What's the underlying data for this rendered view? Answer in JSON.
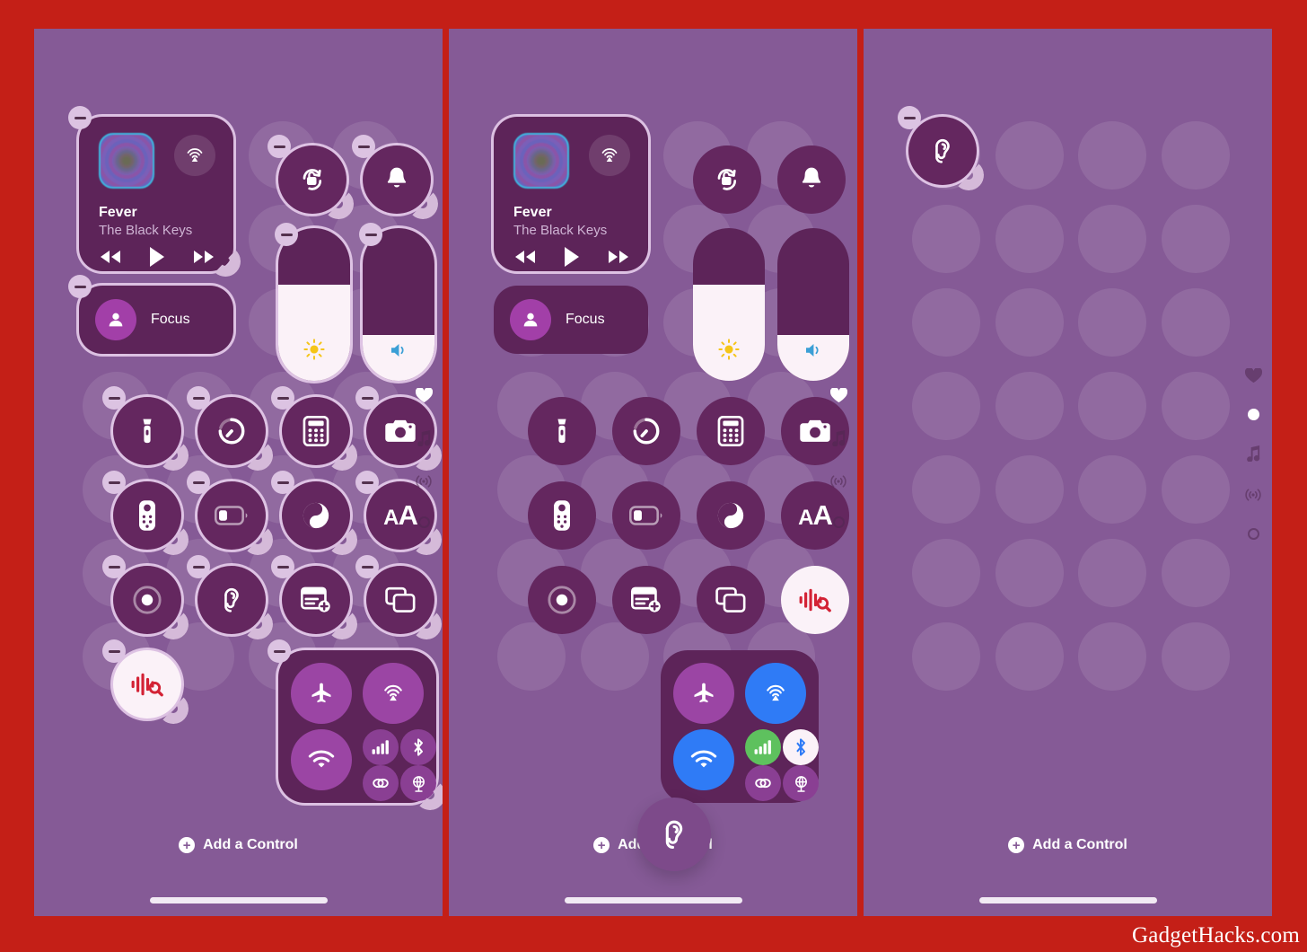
{
  "watermark": "GadgetHacks.com",
  "colors": {
    "border_red": "#c41f17",
    "panel_bg": "#855a96",
    "tile_bg": "#64275f",
    "widget_bg": "#5d2459",
    "minus_badge": "#dcc3e2",
    "handle": "#d5bad9",
    "active_blue": "#2f7bf6",
    "active_green": "#5ec15e",
    "shazam_red": "#d32235",
    "brightness_yellow": "#f5c518",
    "volume_blue": "#3b9fd6"
  },
  "panels": [
    {
      "id": "panel-1",
      "name": "control-center-edit-mode",
      "edit_mode": true,
      "add_control_label": "Add a Control",
      "media": {
        "title": "Fever",
        "artist": "The Black Keys",
        "airplay_icon": "airplay-icon",
        "rewind_icon": "rewind-icon",
        "play_icon": "play-icon",
        "forward_icon": "fast-forward-icon"
      },
      "focus": {
        "label": "Focus",
        "icon": "person-icon"
      },
      "toggles": [
        {
          "name": "rotation-lock",
          "icon": "rotation-lock-icon"
        },
        {
          "name": "ring-silent",
          "icon": "bell-icon"
        }
      ],
      "sliders": [
        {
          "name": "brightness-slider",
          "icon": "sun-icon",
          "level": 63
        },
        {
          "name": "volume-slider",
          "icon": "speaker-icon",
          "level": 30
        }
      ],
      "grid": [
        {
          "name": "flashlight",
          "icon": "flashlight-icon",
          "state": "off"
        },
        {
          "name": "timer",
          "icon": "timer-icon",
          "state": "off"
        },
        {
          "name": "calculator",
          "icon": "calculator-icon",
          "state": "off"
        },
        {
          "name": "camera",
          "icon": "camera-icon",
          "state": "off"
        },
        {
          "name": "apple-tv-remote",
          "icon": "remote-icon",
          "state": "off"
        },
        {
          "name": "low-power-mode",
          "icon": "battery-icon",
          "state": "off"
        },
        {
          "name": "dark-mode",
          "icon": "dark-mode-icon",
          "state": "off"
        },
        {
          "name": "text-size",
          "icon": "text-size-icon",
          "state": "off"
        },
        {
          "name": "screen-record",
          "icon": "screen-record-icon",
          "state": "off"
        },
        {
          "name": "hearing",
          "icon": "ear-icon",
          "state": "off"
        },
        {
          "name": "quick-note",
          "icon": "quick-note-icon",
          "state": "off"
        },
        {
          "name": "screen-mirroring",
          "icon": "screen-mirroring-icon",
          "state": "off"
        },
        {
          "name": "music-recognition",
          "icon": "shazam-icon",
          "state": "on"
        }
      ],
      "connectivity": [
        {
          "name": "airplane-mode",
          "icon": "airplane-icon",
          "state": "off"
        },
        {
          "name": "airdrop",
          "icon": "airdrop-icon",
          "state": "off"
        },
        {
          "name": "wifi",
          "icon": "wifi-icon",
          "state": "off"
        },
        {
          "name": "cellular-data",
          "icon": "cellular-icon",
          "state": "off"
        },
        {
          "name": "bluetooth",
          "icon": "bluetooth-icon",
          "state": "off"
        },
        {
          "name": "personal-hotspot",
          "icon": "hotspot-icon",
          "state": "off"
        },
        {
          "name": "vpn",
          "icon": "vpn-icon",
          "state": "off"
        }
      ],
      "rail": [
        {
          "name": "favorites-page",
          "icon": "heart-icon",
          "active": true
        },
        {
          "name": "music-page",
          "icon": "music-note-icon",
          "active": false
        },
        {
          "name": "connectivity-page",
          "icon": "antenna-icon",
          "active": false
        },
        {
          "name": "extra-page",
          "icon": "circle-outline-icon",
          "active": false
        }
      ]
    },
    {
      "id": "panel-2",
      "name": "control-center-dragging-control",
      "edit_mode": true,
      "add_control_label": "Add a Control",
      "media": {
        "title": "Fever",
        "artist": "The Black Keys",
        "airplay_icon": "airplay-icon",
        "rewind_icon": "rewind-icon",
        "play_icon": "play-icon",
        "forward_icon": "fast-forward-icon"
      },
      "focus": {
        "label": "Focus",
        "icon": "person-icon"
      },
      "toggles": [
        {
          "name": "rotation-lock",
          "icon": "rotation-lock-icon"
        },
        {
          "name": "ring-silent",
          "icon": "bell-icon"
        }
      ],
      "sliders": [
        {
          "name": "brightness-slider",
          "icon": "sun-icon",
          "level": 63
        },
        {
          "name": "volume-slider",
          "icon": "speaker-icon",
          "level": 30
        }
      ],
      "grid": [
        {
          "name": "flashlight",
          "icon": "flashlight-icon",
          "state": "off"
        },
        {
          "name": "timer",
          "icon": "timer-icon",
          "state": "off"
        },
        {
          "name": "calculator",
          "icon": "calculator-icon",
          "state": "off"
        },
        {
          "name": "camera",
          "icon": "camera-icon",
          "state": "off"
        },
        {
          "name": "apple-tv-remote",
          "icon": "remote-icon",
          "state": "off"
        },
        {
          "name": "low-power-mode",
          "icon": "battery-icon",
          "state": "off"
        },
        {
          "name": "dark-mode",
          "icon": "dark-mode-icon",
          "state": "off"
        },
        {
          "name": "text-size",
          "icon": "text-size-icon",
          "state": "off"
        },
        {
          "name": "screen-record",
          "icon": "screen-record-icon",
          "state": "off"
        },
        {
          "name": "quick-note",
          "icon": "quick-note-icon",
          "state": "off"
        },
        {
          "name": "screen-mirroring",
          "icon": "screen-mirroring-icon",
          "state": "off"
        },
        {
          "name": "music-recognition",
          "icon": "shazam-icon",
          "state": "on"
        }
      ],
      "connectivity": [
        {
          "name": "airplane-mode",
          "icon": "airplane-icon",
          "state": "off"
        },
        {
          "name": "airdrop",
          "icon": "airdrop-icon",
          "state": "on"
        },
        {
          "name": "wifi",
          "icon": "wifi-icon",
          "state": "on"
        },
        {
          "name": "cellular-data",
          "icon": "cellular-icon",
          "state": "on"
        },
        {
          "name": "bluetooth",
          "icon": "bluetooth-icon",
          "state": "on"
        },
        {
          "name": "personal-hotspot",
          "icon": "hotspot-icon",
          "state": "off"
        },
        {
          "name": "vpn",
          "icon": "vpn-icon",
          "state": "off"
        }
      ],
      "dragging_control": {
        "name": "hearing",
        "icon": "ear-icon"
      },
      "rail": [
        {
          "name": "favorites-page",
          "icon": "heart-icon",
          "active": true
        },
        {
          "name": "music-page",
          "icon": "music-note-icon",
          "active": false
        },
        {
          "name": "connectivity-page",
          "icon": "antenna-icon",
          "active": false
        },
        {
          "name": "extra-page",
          "icon": "circle-outline-icon",
          "active": false
        }
      ]
    },
    {
      "id": "panel-3",
      "name": "control-center-new-blank-page",
      "edit_mode": true,
      "add_control_label": "Add a Control",
      "grid": [
        {
          "name": "hearing",
          "icon": "ear-icon",
          "state": "off"
        }
      ],
      "rail": [
        {
          "name": "favorites-page",
          "icon": "heart-icon",
          "active": false
        },
        {
          "name": "current-page-dot",
          "icon": "dot-icon",
          "active": true
        },
        {
          "name": "music-page",
          "icon": "music-note-icon",
          "active": false
        },
        {
          "name": "connectivity-page",
          "icon": "antenna-icon",
          "active": false
        },
        {
          "name": "extra-page",
          "icon": "circle-outline-icon",
          "active": false
        }
      ]
    }
  ]
}
